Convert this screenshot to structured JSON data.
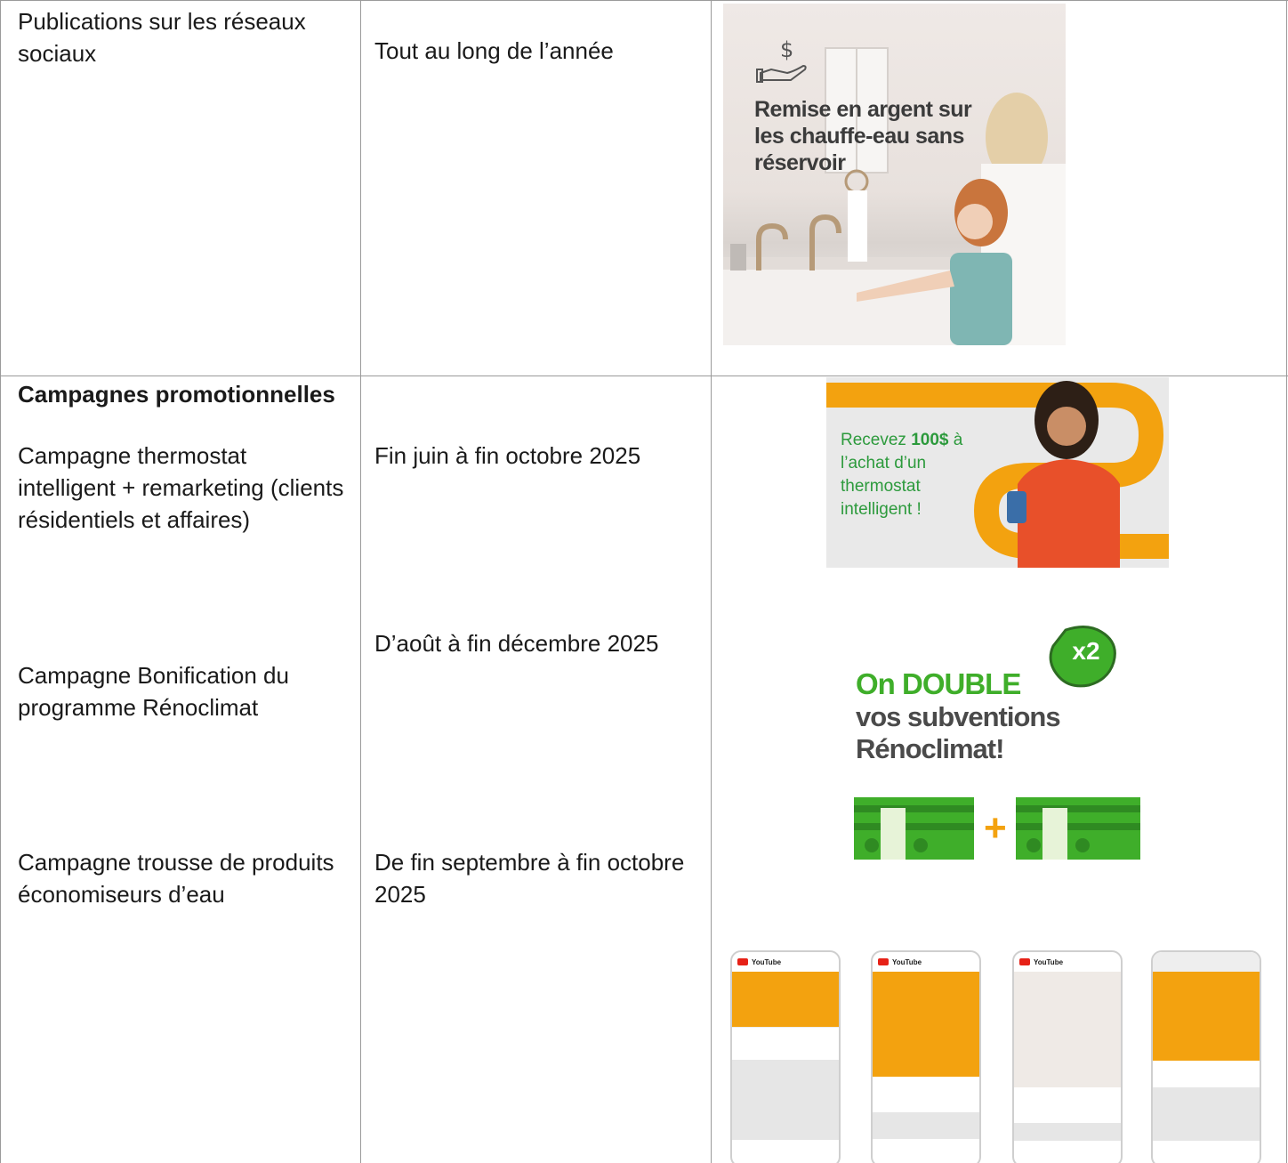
{
  "rows": [
    {
      "channel": "Publications sur les réseaux sociaux",
      "period": "Tout au long de l’année",
      "visual": {
        "title": "Remise en argent sur les chauffe-eau sans réservoir",
        "icon": "cash-hand-icon"
      }
    },
    {
      "section_heading": "Campagnes promotionnelles",
      "items": [
        {
          "channel": "Campagne thermostat intelligent + remarketing (clients résidentiels et affaires)",
          "period": "Fin juin à fin octobre 2025",
          "visual": {
            "text_prefix": "Recevez ",
            "text_amount": "100$",
            "text_suffix": " à l’achat d’un thermostat intelligent !"
          }
        },
        {
          "channel": "Campagne Bonification du programme Rénoclimat",
          "period": "D’août à fin décembre 2025",
          "visual": {
            "line1": "On DOUBLE",
            "line2": "vos subventions Rénoclimat!",
            "badge": "x2",
            "plus": "+"
          }
        },
        {
          "channel": "Campagne trousse de produits économiseurs d’eau",
          "period": "De fin septembre à fin octobre 2025",
          "visual": {
            "app": "YouTube",
            "phone_count": 4
          }
        }
      ]
    }
  ],
  "colors": {
    "border": "#9a9a9a",
    "green": "#3fae2a",
    "orange": "#f3a20f",
    "text": "#1a1a1a"
  }
}
